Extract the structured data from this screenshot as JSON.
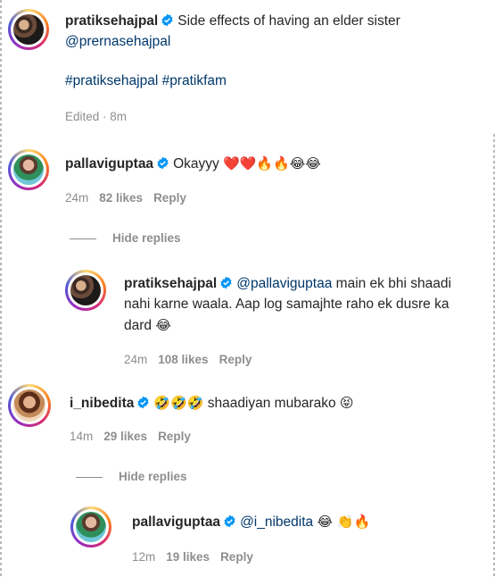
{
  "caption": {
    "username": "pratiksehajpal",
    "text": "Side effects of having an elder sister",
    "mention": "@prernasehajpal",
    "hashtags": "#pratiksehajpal #pratikfam",
    "edited": "Edited · 8m"
  },
  "comments": [
    {
      "username": "pallaviguptaa",
      "text": "Okayyy",
      "emojis": "❤️❤️🔥🔥😂😂",
      "time": "24m",
      "likes": "82 likes",
      "reply": "Reply",
      "hide_replies": "Hide replies"
    },
    {
      "username": "pratiksehajpal",
      "mention": "@pallaviguptaa",
      "text_line1": "main ek bhi shaadi",
      "text_line2": "nahi karne waala. Aap log samajhte raho ek dusre ka",
      "text_line3": "dard",
      "emoji3": "😂",
      "time": "24m",
      "likes": "108 likes",
      "reply": "Reply"
    },
    {
      "username": "i_nibedita",
      "emojis_pre": "🤣🤣🤣",
      "text": "shaadiyan mubarako",
      "emoji_post": "😝",
      "time": "14m",
      "likes": "29 likes",
      "reply": "Reply",
      "hide_replies": "Hide replies"
    },
    {
      "username": "pallaviguptaa",
      "mention": "@i_nibedita",
      "emojis": "😂 👏🔥",
      "time": "12m",
      "likes": "19 likes",
      "reply": "Reply"
    }
  ],
  "colors": {
    "verified": "#0095f6",
    "link": "#00376b",
    "meta": "#8e8e8e"
  }
}
